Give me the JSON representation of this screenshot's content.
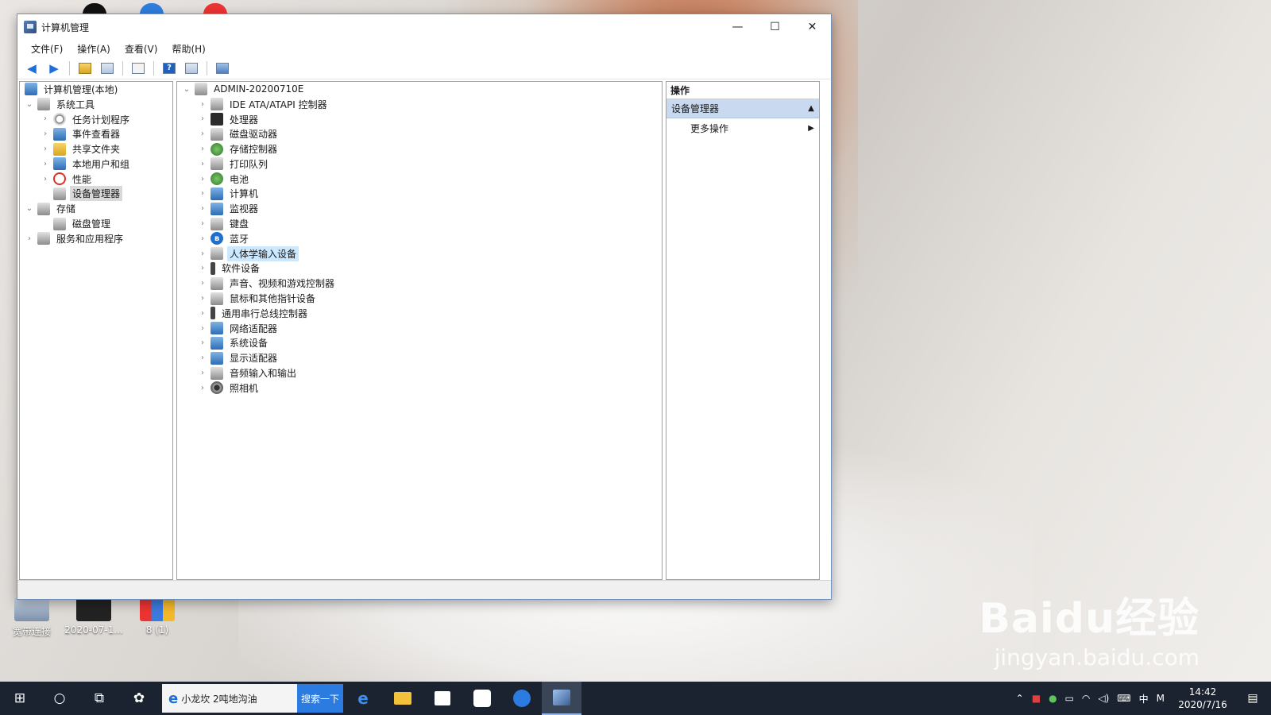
{
  "window": {
    "title": "计算机管理",
    "controls": {
      "minimize": "—",
      "maximize": "☐",
      "close": "✕"
    }
  },
  "menubar": [
    "文件(F)",
    "操作(A)",
    "查看(V)",
    "帮助(H)"
  ],
  "left_tree": {
    "root": "计算机管理(本地)",
    "system_tools": "系统工具",
    "items": [
      "任务计划程序",
      "事件查看器",
      "共享文件夹",
      "本地用户和组",
      "性能",
      "设备管理器"
    ],
    "storage": "存储",
    "disk": "磁盘管理",
    "services": "服务和应用程序"
  },
  "device_tree": {
    "root": "ADMIN-20200710E",
    "categories": [
      "IDE ATA/ATAPI 控制器",
      "处理器",
      "磁盘驱动器",
      "存储控制器",
      "打印队列",
      "电池",
      "计算机",
      "监视器",
      "键盘",
      "蓝牙",
      "人体学输入设备",
      "软件设备",
      "声音、视频和游戏控制器",
      "鼠标和其他指针设备",
      "通用串行总线控制器",
      "网络适配器",
      "系统设备",
      "显示适配器",
      "音频输入和输出",
      "照相机"
    ]
  },
  "actions": {
    "header": "操作",
    "section": "设备管理器",
    "item": "更多操作"
  },
  "desktop": {
    "icons": [
      "宽带连接",
      "2020-07-1...",
      "8 (1)"
    ]
  },
  "taskbar": {
    "search_text": "小龙坎 2吨地沟油",
    "search_button": "搜索一下",
    "ime": "中",
    "ime_mode": "M",
    "time": "14:42",
    "date": "2020/7/16"
  },
  "watermark": {
    "main": "Baidu经验",
    "url": "jingyan.baidu.com"
  },
  "colors": {
    "selection": "#cce8ff",
    "actions_bar": "#c9daf0",
    "taskbar": "#1c2330",
    "accent": "#2b7be0"
  }
}
